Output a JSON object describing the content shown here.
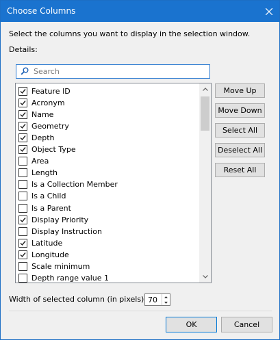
{
  "window": {
    "title": "Choose Columns"
  },
  "instructions": "Select the columns you want to display in the selection window.",
  "details_label": "Details:",
  "search": {
    "placeholder": "Search"
  },
  "columns": [
    {
      "label": "Feature ID",
      "checked": true
    },
    {
      "label": "Acronym",
      "checked": true
    },
    {
      "label": "Name",
      "checked": true
    },
    {
      "label": "Geometry",
      "checked": true
    },
    {
      "label": "Depth",
      "checked": true
    },
    {
      "label": "Object Type",
      "checked": true
    },
    {
      "label": "Area",
      "checked": false
    },
    {
      "label": "Length",
      "checked": false
    },
    {
      "label": "Is a Collection Member",
      "checked": false
    },
    {
      "label": "Is a Child",
      "checked": false
    },
    {
      "label": "Is a Parent",
      "checked": false
    },
    {
      "label": "Display Priority",
      "checked": true
    },
    {
      "label": "Display Instruction",
      "checked": false
    },
    {
      "label": "Latitude",
      "checked": true
    },
    {
      "label": "Longitude",
      "checked": true
    },
    {
      "label": "Scale minimum",
      "checked": false
    },
    {
      "label": "Depth range value 1",
      "checked": false
    }
  ],
  "buttons": {
    "move_up": "Move Up",
    "move_down": "Move Down",
    "select_all": "Select All",
    "deselect_all": "Deselect All",
    "reset_all": "Reset All",
    "ok": "OK",
    "cancel": "Cancel"
  },
  "width_setting": {
    "label": "Width of selected column (in pixels):",
    "value": "70"
  },
  "colors": {
    "titlebar": "#1a73cf",
    "dialog_background": "#f0f0f0",
    "focus_border": "#2c7bd1"
  }
}
